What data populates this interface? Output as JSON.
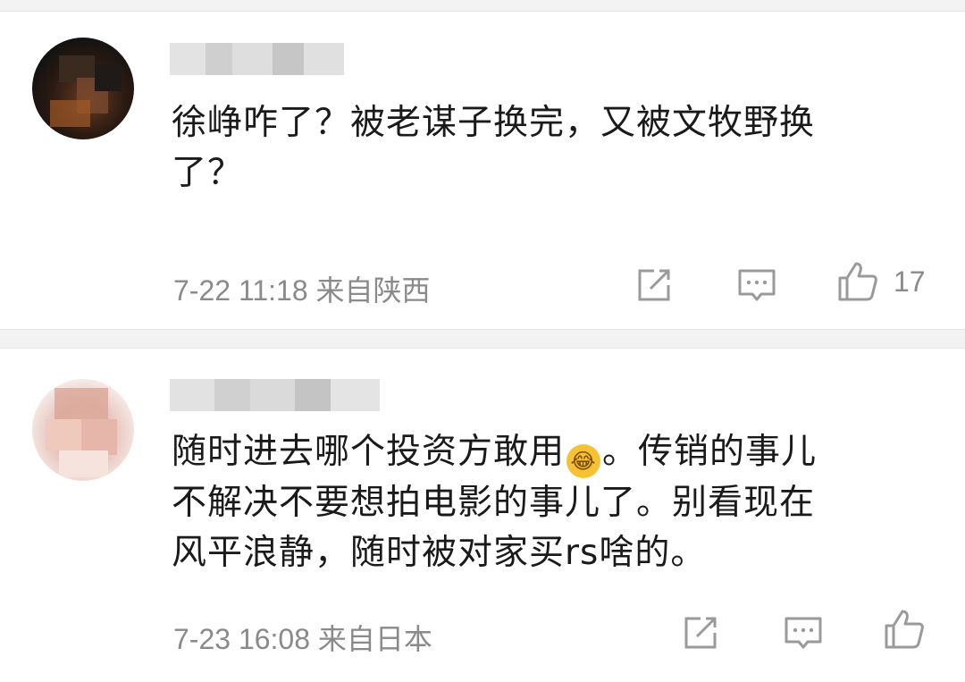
{
  "comments": [
    {
      "text_lines": [
        "徐峥咋了？被老谋子换完，又被文牧野换",
        "了？"
      ],
      "time": "7-22 11:18",
      "location": "来自陕西",
      "likes": "17",
      "icons": {
        "share": "share-icon",
        "comment": "comment-icon",
        "like": "thumbs-up-icon"
      }
    },
    {
      "text_part1": "随时进去哪个投资方敢用",
      "emoji": "😂",
      "text_part2": "。传销的事儿",
      "text_lines": [
        "不解决不要想拍电影的事儿了。别看现在",
        "风平浪静，随时被对家买rs啥的。"
      ],
      "time": "7-23 16:08",
      "location": "来自日本",
      "likes": "",
      "icons": {
        "share": "share-icon",
        "comment": "comment-icon",
        "like": "thumbs-up-icon"
      }
    }
  ],
  "colors": {
    "text": "#1a1a1a",
    "meta": "#8a8a8a",
    "icon": "#9a9a9a",
    "divider": "#f2f2f2"
  }
}
